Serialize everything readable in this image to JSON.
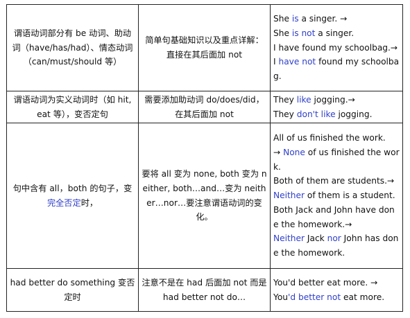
{
  "rows": [
    {
      "col1": "谓语动词部分有 be 动词、助动词（have/has/had）、情态动词（can/must/should 等）",
      "col2": "简单句基础知识以及重点详解：直接在其后面加 not",
      "examples": [
        {
          "segments": [
            {
              "t": "She ",
              "hl": false
            },
            {
              "t": "is",
              "hl": true
            },
            {
              "t": " a singer. →",
              "hl": false
            }
          ]
        },
        {
          "segments": [
            {
              "t": "She ",
              "hl": false
            },
            {
              "t": "is not",
              "hl": true
            },
            {
              "t": " a singer.",
              "hl": false
            }
          ]
        },
        {
          "segments": [
            {
              "t": "I have found my schoolbag.→",
              "hl": false
            }
          ]
        },
        {
          "segments": [
            {
              "t": "I ",
              "hl": false
            },
            {
              "t": "have not",
              "hl": true
            },
            {
              "t": " found my schoolbag.",
              "hl": false
            }
          ]
        }
      ]
    },
    {
      "col1": "谓语动词为实义动词时（如 hit, eat 等），变否定句",
      "col2": "需要添加助动词 do/does/did，在其后面加 not",
      "examples": [
        {
          "segments": [
            {
              "t": "They ",
              "hl": false
            },
            {
              "t": "like",
              "hl": true
            },
            {
              "t": " jogging.→",
              "hl": false
            }
          ]
        },
        {
          "segments": [
            {
              "t": "They ",
              "hl": false
            },
            {
              "t": "don't like",
              "hl": true
            },
            {
              "t": " jogging.",
              "hl": false
            }
          ]
        }
      ]
    },
    {
      "col1_prefix": "句中含有 all，both 的句子，变",
      "col1_highlight": "完全否定",
      "col1_suffix": "时，",
      "col2": "要将 all 变为 none, both 变为 neither, both…and…变为 neither…nor…要注意谓语动词的变化。",
      "examples": [
        {
          "segments": [
            {
              "t": "All of us finished the work.",
              "hl": false
            }
          ]
        },
        {
          "segments": [
            {
              "t": "→ ",
              "hl": false
            },
            {
              "t": "None",
              "hl": true
            },
            {
              "t": " of us finished the work.",
              "hl": false
            }
          ]
        },
        {
          "segments": [
            {
              "t": "Both of them are students.→",
              "hl": false
            }
          ]
        },
        {
          "segments": [
            {
              "t": "Neither",
              "hl": true
            },
            {
              "t": " of them is a student.",
              "hl": false
            }
          ]
        },
        {
          "segments": [
            {
              "t": "Both Jack and John have done the homework.→",
              "hl": false
            }
          ]
        },
        {
          "segments": [
            {
              "t": "Neither",
              "hl": true
            },
            {
              "t": " Jack ",
              "hl": false
            },
            {
              "t": "nor",
              "hl": true
            },
            {
              "t": " John has done the homework.",
              "hl": false
            }
          ]
        }
      ]
    },
    {
      "col1": "had better do something 变否定时",
      "col2": "注意不是在 had 后面加 not 而是 had better not do…",
      "examples": [
        {
          "segments": [
            {
              "t": "You'd better eat more. →",
              "hl": false
            }
          ]
        },
        {
          "segments": [
            {
              "t": "You",
              "hl": false
            },
            {
              "t": "'d better not",
              "hl": true
            },
            {
              "t": " eat more.",
              "hl": false
            }
          ]
        }
      ]
    }
  ]
}
